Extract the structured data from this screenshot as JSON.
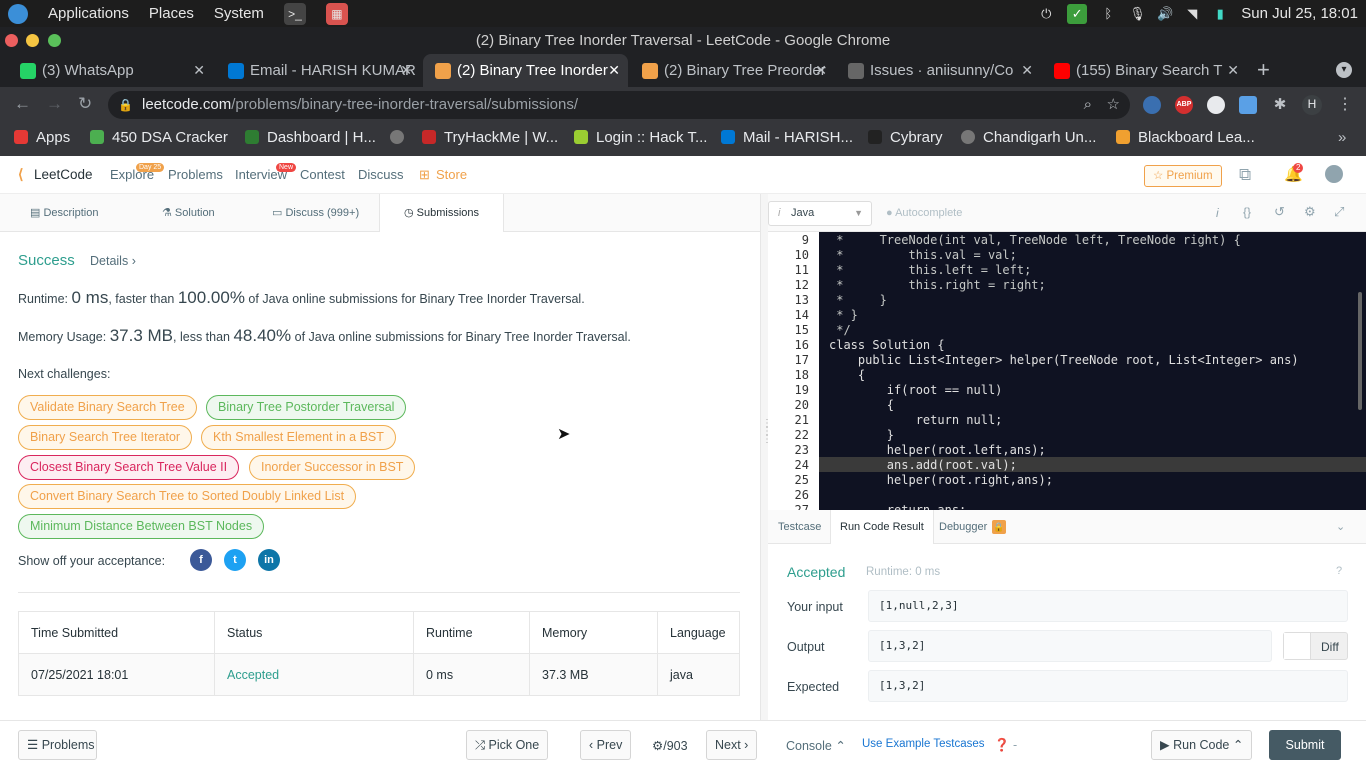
{
  "os": {
    "menu": [
      "Applications",
      "Places",
      "System"
    ],
    "clock": "Sun Jul 25, 18:01"
  },
  "window_title": "(2) Binary Tree Inorder Traversal - LeetCode - Google Chrome",
  "tabs": [
    {
      "label": "(3) WhatsApp",
      "color": "#25d366"
    },
    {
      "label": "Email - HARISH KUMAR",
      "color": "#0078d4"
    },
    {
      "label": "(2) Binary Tree Inorder",
      "color": "#f0a14a"
    },
    {
      "label": "(2) Binary Tree Preorder",
      "color": "#f0a14a"
    },
    {
      "label": "Issues · aniisunny/Co",
      "color": "#666666"
    },
    {
      "label": "(155) Binary Search T",
      "color": "#ff0000"
    }
  ],
  "address": {
    "host": "leetcode.com",
    "path": "/problems/binary-tree-inorder-traversal/submissions/"
  },
  "profile_initial": "H",
  "abp_label": "ABP",
  "bookmarks": [
    {
      "label": "Apps",
      "color": "#e53935"
    },
    {
      "label": "450 DSA Cracker",
      "color": "#4caf50"
    },
    {
      "label": "Dashboard | H...",
      "color": "#2e7d32"
    },
    {
      "label": "",
      "color": "#777777"
    },
    {
      "label": "TryHackMe | W...",
      "color": "#c62828"
    },
    {
      "label": "Login :: Hack T...",
      "color": "#9acd32"
    },
    {
      "label": "Mail - HARISH...",
      "color": "#0078d4"
    },
    {
      "label": "Cybrary",
      "color": "#222222"
    },
    {
      "label": "Chandigarh Un...",
      "color": "#777777"
    },
    {
      "label": "Blackboard Lea...",
      "color": "#f0a030"
    }
  ],
  "lc_nav": {
    "logo": "LeetCode",
    "items": [
      "Explore",
      "Problems",
      "Interview",
      "Contest",
      "Discuss",
      "Store"
    ],
    "explore_badge": "Day 25",
    "interview_badge": "New",
    "premium": "Premium",
    "notif_count": "2"
  },
  "subtabs": [
    "Description",
    "Solution",
    "Discuss (999+)",
    "Submissions"
  ],
  "result": {
    "status": "Success",
    "details": "Details",
    "runtime_label": "Runtime: ",
    "runtime_value": "0 ms",
    "runtime_mid": ", faster than ",
    "runtime_pct": "100.00%",
    "runtime_tail": " of Java online submissions for Binary Tree Inorder Traversal.",
    "mem_label": "Memory Usage: ",
    "mem_value": "37.3 MB",
    "mem_mid": ", less than ",
    "mem_pct": "48.40%",
    "mem_tail": " of Java online submissions for Binary Tree Inorder Traversal.",
    "next_label": "Next challenges:",
    "challenges": [
      {
        "label": "Validate Binary Search Tree",
        "level": "m"
      },
      {
        "label": "Binary Tree Postorder Traversal",
        "level": "e"
      },
      {
        "label": "Binary Search Tree Iterator",
        "level": "m"
      },
      {
        "label": "Kth Smallest Element in a BST",
        "level": "m"
      },
      {
        "label": "Closest Binary Search Tree Value II",
        "level": "h"
      },
      {
        "label": "Inorder Successor in BST",
        "level": "m"
      },
      {
        "label": "Convert Binary Search Tree to Sorted Doubly Linked List",
        "level": "m"
      },
      {
        "label": "Minimum Distance Between BST Nodes",
        "level": "e"
      }
    ],
    "share_label": "Show off your acceptance:"
  },
  "submissions_table": {
    "headers": [
      "Time Submitted",
      "Status",
      "Runtime",
      "Memory",
      "Language"
    ],
    "rows": [
      [
        "07/25/2021 18:01",
        "Accepted",
        "0 ms",
        "37.3 MB",
        "java"
      ]
    ]
  },
  "editor": {
    "language": "Java",
    "autocomplete": "Autocomplete",
    "lines": [
      {
        "n": "9",
        "code": " *     TreeNode(int val, TreeNode left, TreeNode right) {"
      },
      {
        "n": "10",
        "code": " *         this.val = val;"
      },
      {
        "n": "11",
        "code": " *         this.left = left;"
      },
      {
        "n": "12",
        "code": " *         this.right = right;"
      },
      {
        "n": "13",
        "code": " *     }"
      },
      {
        "n": "14",
        "code": " * }"
      },
      {
        "n": "15",
        "code": " */"
      },
      {
        "n": "16",
        "code": "class Solution {"
      },
      {
        "n": "17",
        "code": "    public List<Integer> helper(TreeNode root, List<Integer> ans)"
      },
      {
        "n": "18",
        "code": "    {"
      },
      {
        "n": "19",
        "code": "        if(root == null)"
      },
      {
        "n": "20",
        "code": "        {"
      },
      {
        "n": "21",
        "code": "            return null;"
      },
      {
        "n": "22",
        "code": "        }"
      },
      {
        "n": "23",
        "code": "        helper(root.left,ans);"
      },
      {
        "n": "24",
        "code": "        ans.add(root.val);"
      },
      {
        "n": "25",
        "code": "        helper(root.right,ans);"
      },
      {
        "n": "26",
        "code": ""
      },
      {
        "n": "27",
        "code": "        return ans;"
      }
    ]
  },
  "run_panel": {
    "tabs": [
      "Testcase",
      "Run Code Result",
      "Debugger"
    ],
    "status": "Accepted",
    "runtime": "Runtime: 0 ms",
    "input_label": "Your input",
    "input": "[1,null,2,3]",
    "output_label": "Output",
    "output": "[1,3,2]",
    "diff": "Diff",
    "expected_label": "Expected",
    "expected": "[1,3,2]"
  },
  "footer": {
    "problems": "Problems",
    "pick_one": "Pick One",
    "prev": "Prev",
    "counter": "/903",
    "next": "Next",
    "console": "Console",
    "example": "Use Example Testcases",
    "help_suffix": "-",
    "run": "Run Code",
    "submit": "Submit"
  }
}
